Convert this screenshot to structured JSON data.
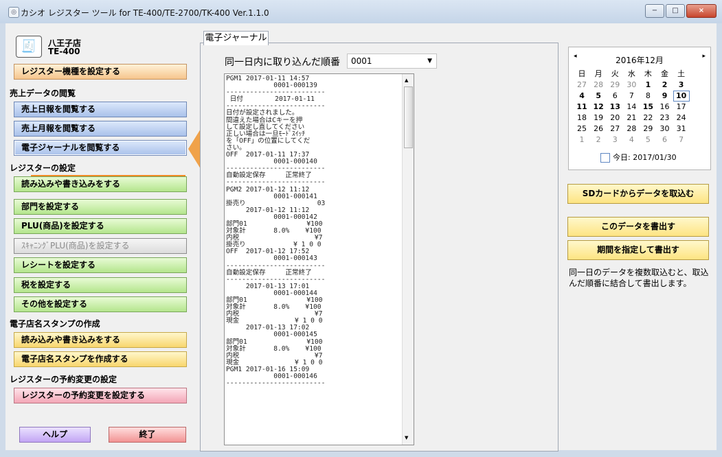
{
  "window": {
    "title": "カシオ レジスター ツール for TE-400/TE-2700/TK-400 Ver.1.1.0",
    "icon": "app-icon",
    "buttons": {
      "minimize": "−",
      "maximize": "□",
      "close": "×"
    }
  },
  "sidebar": {
    "store_name": "八王子店",
    "model": "TE-400",
    "store_icon": "cash-register-icon",
    "buttons": {
      "register_model": "レジスター機種を設定する",
      "daily": "売上日報を閲覧する",
      "monthly": "売上月報を閲覧する",
      "journal": "電子ジャーナルを閲覧する",
      "readwrite_settings": "読み込みや書き込みをする",
      "department": "部門を設定する",
      "plu": "PLU(商品)を設定する",
      "scanning_plu": "ｽｷｬﾆﾝｸﾞPLU(商品)を設定する",
      "receipt": "レシートを設定する",
      "tax": "税を設定する",
      "other": "その他を設定する",
      "stamp_readwrite": "読み込みや書き込みをする",
      "stamp_create": "電子店名スタンプを作成する",
      "reserve": "レジスターの予約変更を設定する",
      "help": "ヘルプ",
      "exit": "終了"
    },
    "sections": {
      "sales": "売上データの閲覧",
      "register": "レジスターの設定",
      "stamp": "電子店名スタンプの作成",
      "reservation": "レジスターの予約変更の設定"
    }
  },
  "main": {
    "tab": "電子ジャーナル",
    "order_label": "同一日内に取り込んだ順番",
    "order_value": "0001",
    "journal_lines": [
      "PGM1 2017-01-11 14:57",
      "            0001-000139",
      "-------------------------",
      " 日付        2017-01-11",
      "-------------------------",
      "日付が設定されました。",
      "間違えた場合はCキーを押",
      "して設定し直してください",
      "正しい場合は一旦ﾓｰﾄﾞｽｲｯﾁ",
      "を「OFF」の位置にしてくだ",
      "さい。",
      "OFF  2017-01-11 17:37",
      "            0001-000140",
      "-------------------------",
      "自動設定保存     正常終了",
      "-------------------------",
      "PGM2 2017-01-12 11:12",
      "            0001-000141",
      "掛売り                  03",
      "     2017-01-12 11:12",
      "            0001-000142",
      "部門01               ¥100",
      "対象計       8.0%    ¥100",
      "内税                   ¥7",
      "掛売り            ¥ 1 0 0",
      "OFF  2017-01-12 17:52",
      "            0001-000143",
      "-------------------------",
      "自動設定保存     正常終了",
      "-------------------------",
      "     2017-01-13 17:01",
      "            0001-000144",
      "部門01               ¥100",
      "対象計       8.0%    ¥100",
      "内税                   ¥7",
      "現金              ¥ 1 0 0",
      "     2017-01-13 17:02",
      "            0001-000145",
      "部門01               ¥100",
      "対象計       8.0%    ¥100",
      "内税                   ¥7",
      "現金              ¥ 1 0 0",
      "PGM1 2017-01-16 15:09",
      "            0001-000146",
      "-------------------------"
    ]
  },
  "calendar": {
    "month_label": "2016年12月",
    "prev": "◂",
    "next": "▸",
    "weekdays": [
      "日",
      "月",
      "火",
      "水",
      "木",
      "金",
      "土"
    ],
    "weeks": [
      [
        "27",
        "28",
        "29",
        "30",
        "1",
        "2",
        "3"
      ],
      [
        "4",
        "5",
        "6",
        "7",
        "8",
        "9",
        "10"
      ],
      [
        "11",
        "12",
        "13",
        "14",
        "15",
        "16",
        "17"
      ],
      [
        "18",
        "19",
        "20",
        "21",
        "22",
        "23",
        "24"
      ],
      [
        "25",
        "26",
        "27",
        "28",
        "29",
        "30",
        "31"
      ],
      [
        "1",
        "2",
        "3",
        "4",
        "5",
        "6",
        "7"
      ]
    ],
    "today_label": "今日: 2017/01/30"
  },
  "right_panel": {
    "sd_import": "SDカードからデータを取込む",
    "export_this": "このデータを書出す",
    "export_period": "期間を指定して書出す",
    "note": "同一日のデータを複数取込むと、取込んだ順番に結合して書出します。"
  }
}
